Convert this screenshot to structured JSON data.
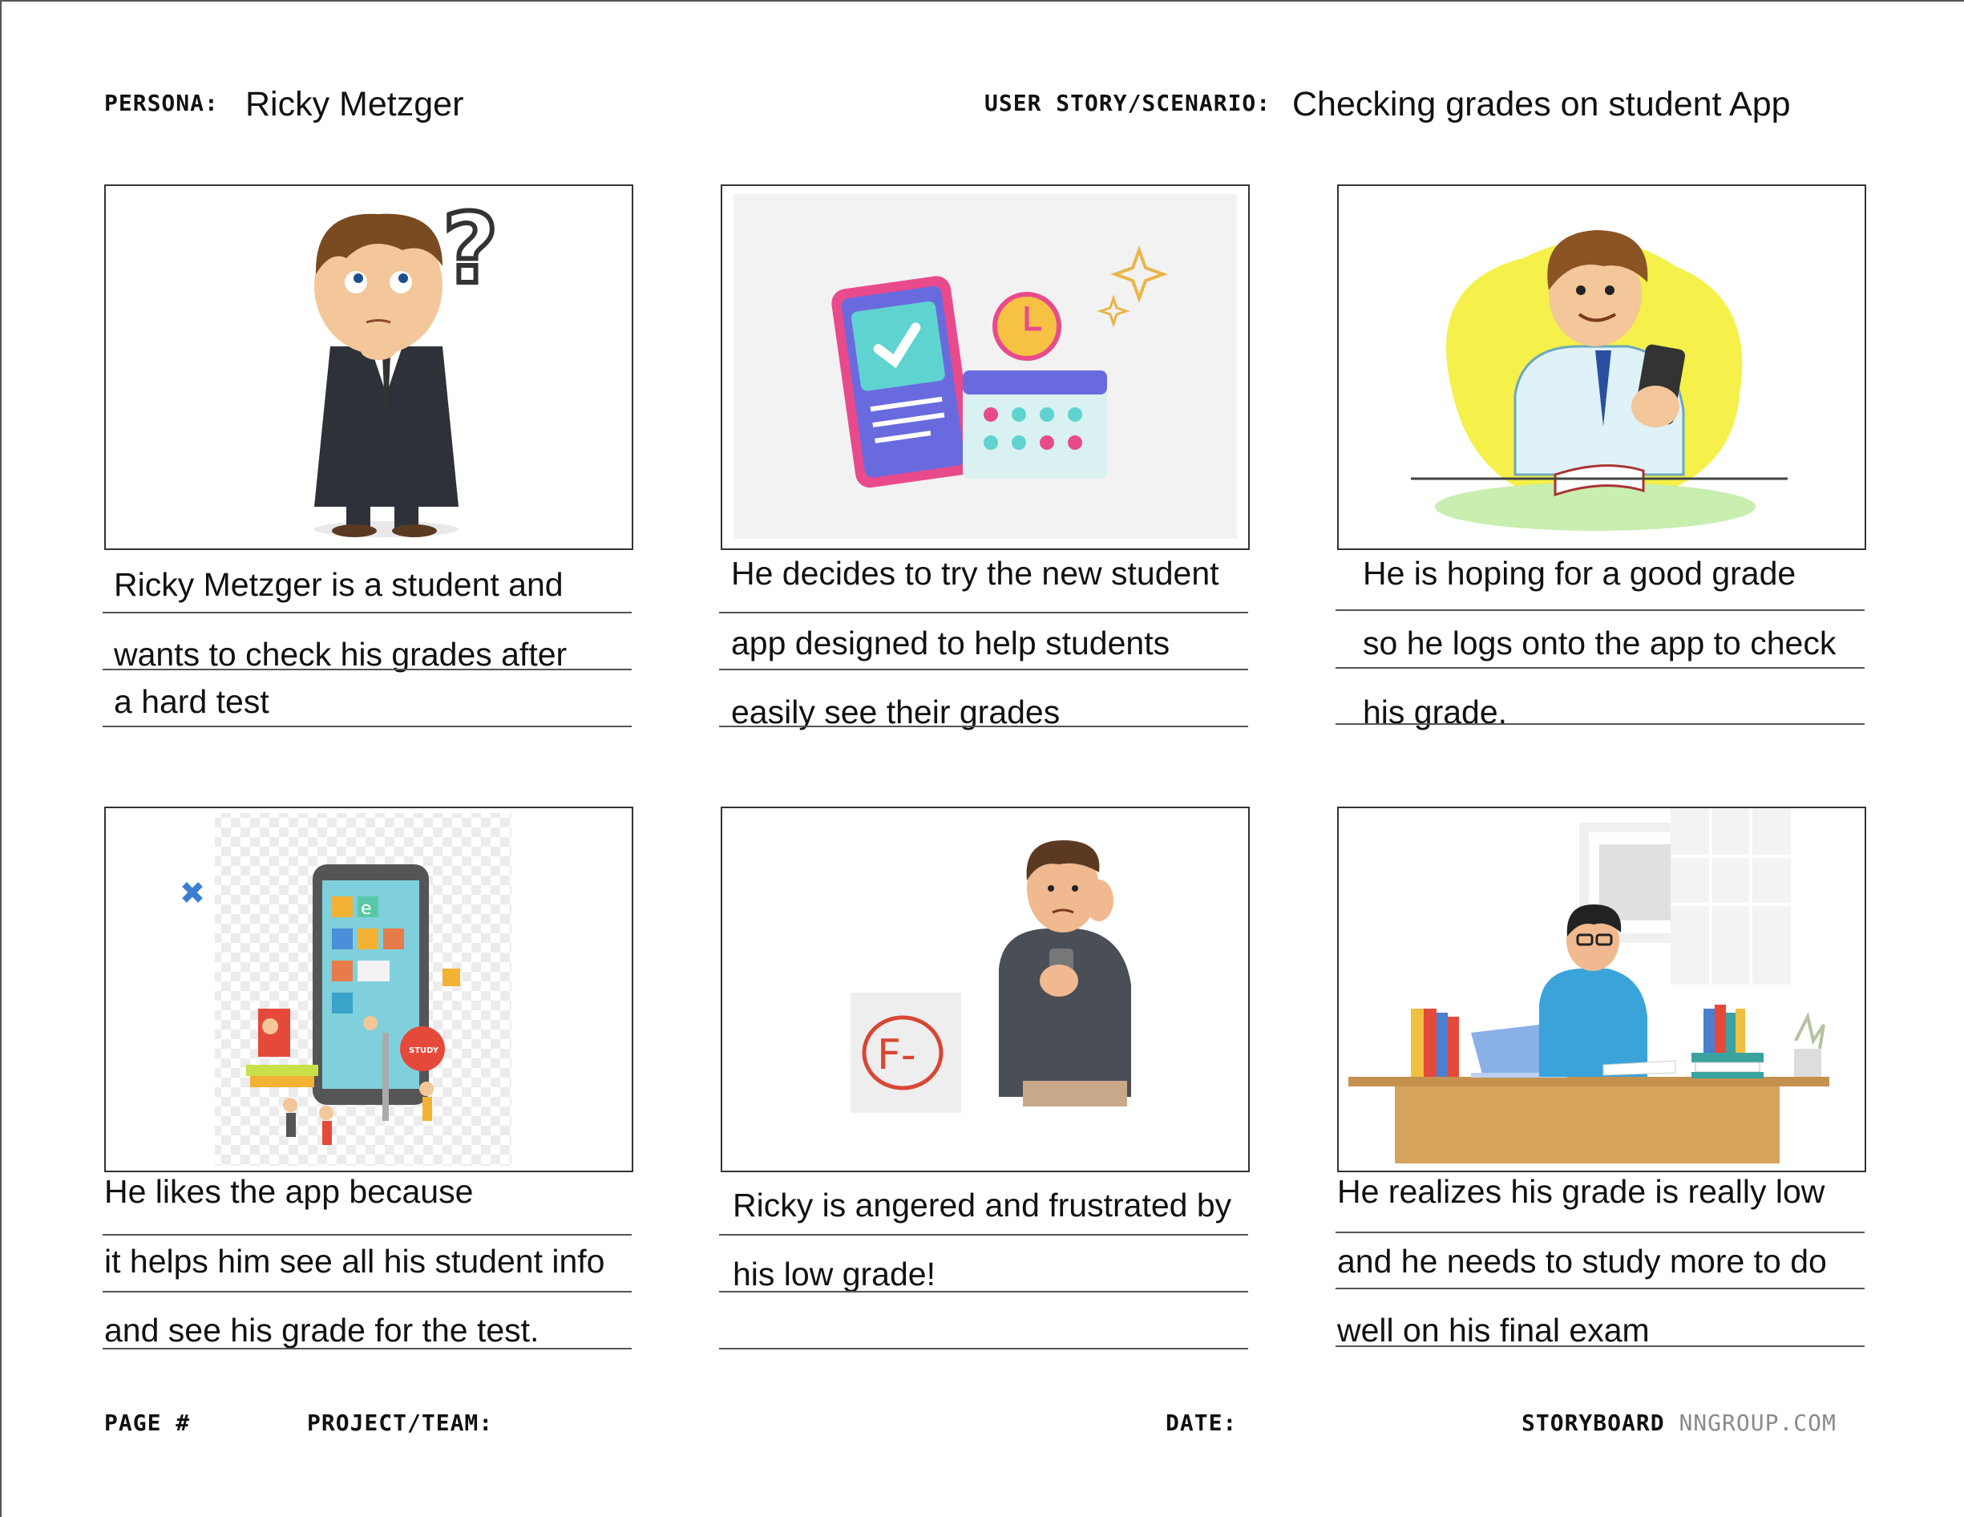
{
  "header": {
    "persona_label": "PERSONA:",
    "persona_value": "Ricky Metzger",
    "scenario_label": "USER STORY/SCENARIO:",
    "scenario_value": "Checking grades on student App"
  },
  "panels": [
    {
      "image": "confused-student-illustration",
      "lines": [
        "Ricky Metzger is a student and",
        "wants to check his grades after",
        " a hard test"
      ]
    },
    {
      "image": "phone-calendar-app-illustration",
      "lines": [
        "He decides to try the new student",
        "app designed to help students",
        "easily see their grades"
      ]
    },
    {
      "image": "student-with-phone-illustration",
      "lines": [
        "He is hoping for a good grade",
        "so he logs onto the app to check",
        "his grade."
      ]
    },
    {
      "image": "education-app-illustration",
      "badge_text": "STUDY",
      "lines": [
        "He likes the app because",
        "it helps him see all his student info",
        "and see his grade for the test."
      ]
    },
    {
      "image": "frustrated-man-with-failing-grade",
      "grade_text": "F-",
      "lines": [
        "Ricky is angered and frustrated by",
        "his low grade!",
        ""
      ]
    },
    {
      "image": "student-studying-at-desk",
      "lines": [
        "He realizes his grade is really low",
        "and he needs to study more to do",
        "well on his final exam"
      ]
    }
  ],
  "footer": {
    "page_label": "PAGE #",
    "project_label": "PROJECT/TEAM:",
    "date_label": "DATE:",
    "brand": "STORYBOARD",
    "site": "NNGROUP.COM"
  }
}
